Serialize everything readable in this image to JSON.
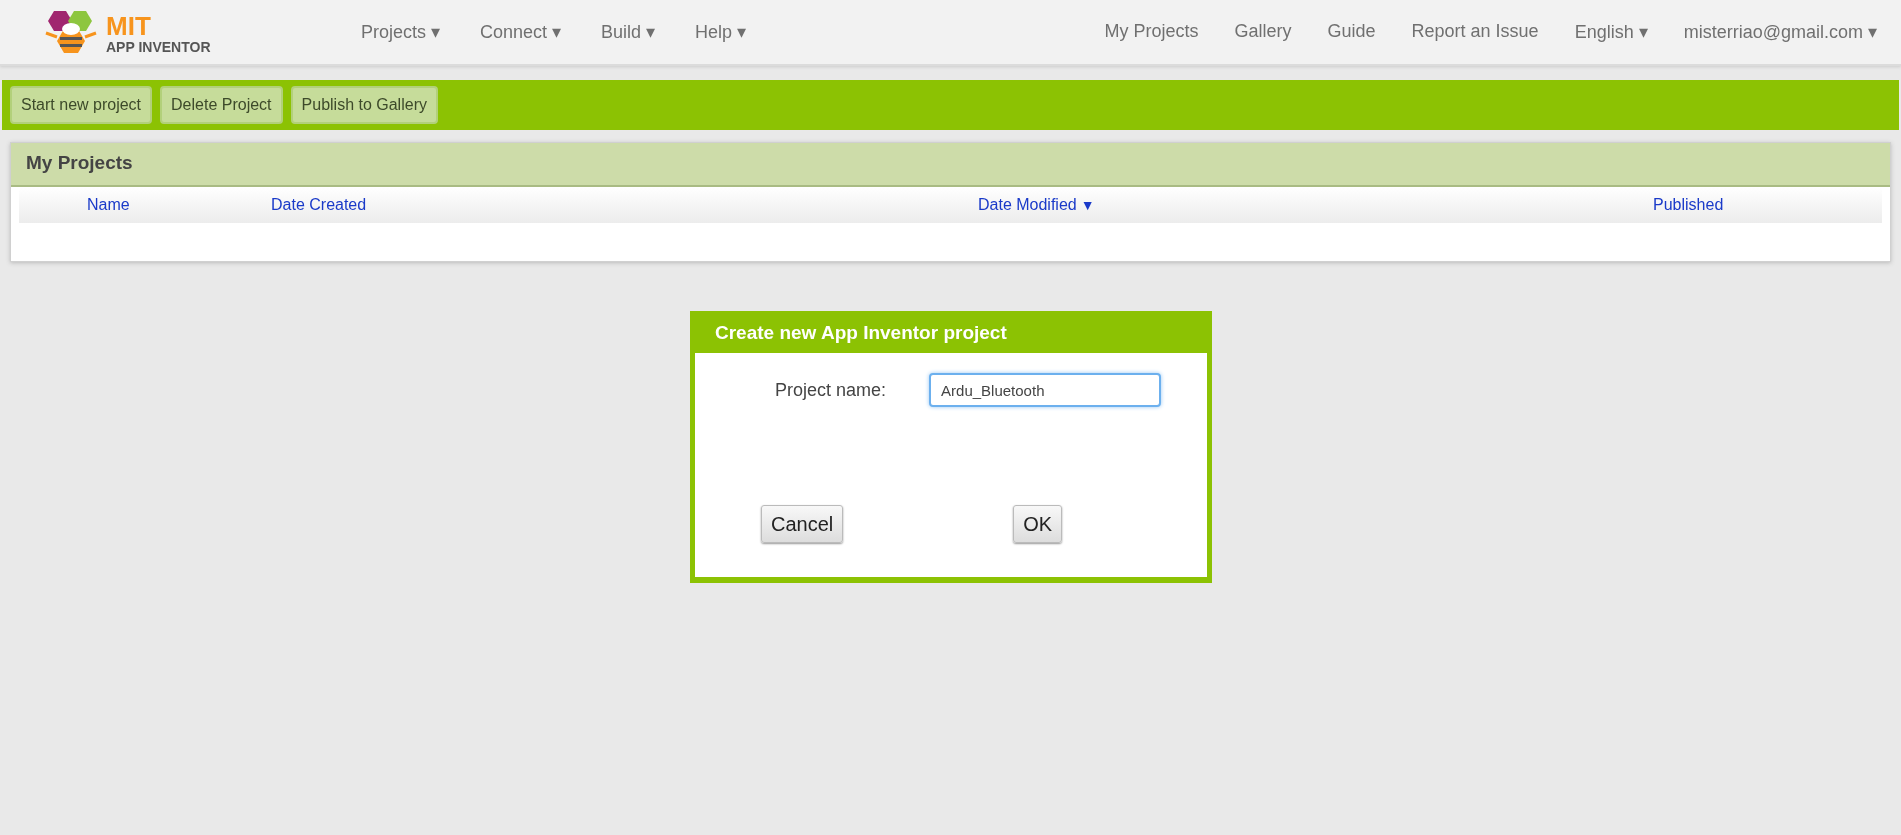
{
  "header": {
    "logo": {
      "line_1": "MIT",
      "line_2": "APP INVENTOR"
    },
    "menus": [
      {
        "label": "Projects ▾"
      },
      {
        "label": "Connect ▾"
      },
      {
        "label": "Build ▾"
      },
      {
        "label": "Help ▾"
      }
    ],
    "links": [
      {
        "label": "My Projects"
      },
      {
        "label": "Gallery"
      },
      {
        "label": "Guide"
      },
      {
        "label": "Report an Issue"
      },
      {
        "label": "English ▾"
      },
      {
        "label": "misterriao@gmail.com ▾"
      }
    ]
  },
  "toolbar": {
    "buttons": [
      "Start new project",
      "Delete Project",
      "Publish to Gallery"
    ]
  },
  "projects_panel": {
    "title": "My Projects",
    "columns": [
      {
        "label": "Name"
      },
      {
        "label": "Date Created"
      },
      {
        "label": "Date Modified",
        "sort_mark": "▼"
      },
      {
        "label": "Published"
      }
    ]
  },
  "dialog": {
    "title": "Create new App Inventor project",
    "field_label": "Project name:",
    "field_value": "Ardu_Bluetooth",
    "field_focused": true,
    "buttons": [
      "Cancel",
      "OK"
    ]
  }
}
